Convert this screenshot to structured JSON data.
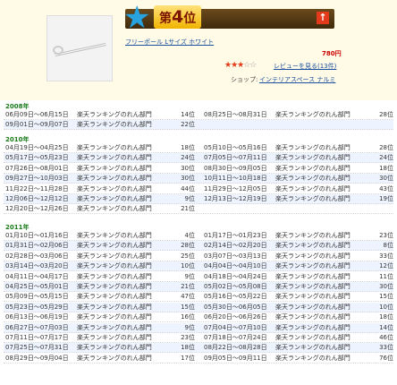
{
  "rank": {
    "prefix": "第",
    "number": "4",
    "suffix": "位",
    "arrow": "↑"
  },
  "product": {
    "name": "フリーポール Lサイズ ホワイト",
    "price": "780円",
    "stars_filled": "★★★",
    "stars_empty": "☆☆",
    "review_link": "レビューを見る(13件)",
    "shop_label": "ショップ:",
    "shop_name": "インテリアスペース ナルミ"
  },
  "history": [
    {
      "year": "2008年",
      "rows": [
        {
          "l_dates": "06月09日～06月15日",
          "l_cat": "楽天ランキングのれん部門",
          "l_pos": "14位",
          "r_dates": "08月25日～08月31日",
          "r_cat": "楽天ランキングのれん部門",
          "r_pos": "28位"
        },
        {
          "l_dates": "09月01日～09月07日",
          "l_cat": "楽天ランキングのれん部門",
          "l_pos": "22位",
          "r_dates": "",
          "r_cat": "",
          "r_pos": ""
        }
      ]
    },
    {
      "year": "2010年",
      "rows": [
        {
          "l_dates": "04月19日～04月25日",
          "l_cat": "楽天ランキングのれん部門",
          "l_pos": "18位",
          "r_dates": "05月10日～05月16日",
          "r_cat": "楽天ランキングのれん部門",
          "r_pos": "28位"
        },
        {
          "l_dates": "05月17日～05月23日",
          "l_cat": "楽天ランキングのれん部門",
          "l_pos": "24位",
          "r_dates": "07月05日～07月11日",
          "r_cat": "楽天ランキングのれん部門",
          "r_pos": "24位"
        },
        {
          "l_dates": "07月26日～08月01日",
          "l_cat": "楽天ランキングのれん部門",
          "l_pos": "30位",
          "r_dates": "08月30日～09月05日",
          "r_cat": "楽天ランキングのれん部門",
          "r_pos": "18位"
        },
        {
          "l_dates": "09月27日～10月03日",
          "l_cat": "楽天ランキングのれん部門",
          "l_pos": "30位",
          "r_dates": "10月11日～10月18日",
          "r_cat": "楽天ランキングのれん部門",
          "r_pos": "30位"
        },
        {
          "l_dates": "11月22日～11月28日",
          "l_cat": "楽天ランキングのれん部門",
          "l_pos": "44位",
          "r_dates": "11月29日～12月05日",
          "r_cat": "楽天ランキングのれん部門",
          "r_pos": "43位"
        },
        {
          "l_dates": "12月06日～12月12日",
          "l_cat": "楽天ランキングのれん部門",
          "l_pos": "9位",
          "r_dates": "12月13日～12月19日",
          "r_cat": "楽天ランキングのれん部門",
          "r_pos": "19位"
        },
        {
          "l_dates": "12月20日～12月26日",
          "l_cat": "楽天ランキングのれん部門",
          "l_pos": "21位",
          "r_dates": "",
          "r_cat": "",
          "r_pos": ""
        }
      ]
    },
    {
      "year": "2011年",
      "rows": [
        {
          "l_dates": "01月10日～01月16日",
          "l_cat": "楽天ランキングのれん部門",
          "l_pos": "4位",
          "r_dates": "01月17日～01月23日",
          "r_cat": "楽天ランキングのれん部門",
          "r_pos": "23位"
        },
        {
          "l_dates": "01月31日～02月06日",
          "l_cat": "楽天ランキングのれん部門",
          "l_pos": "28位",
          "r_dates": "02月14日～02月20日",
          "r_cat": "楽天ランキングのれん部門",
          "r_pos": "8位"
        },
        {
          "l_dates": "02月28日～03月06日",
          "l_cat": "楽天ランキングのれん部門",
          "l_pos": "25位",
          "r_dates": "03月07日～03月13日",
          "r_cat": "楽天ランキングのれん部門",
          "r_pos": "33位"
        },
        {
          "l_dates": "03月14日～03月20日",
          "l_cat": "楽天ランキングのれん部門",
          "l_pos": "10位",
          "r_dates": "04月04日～04月10日",
          "r_cat": "楽天ランキングのれん部門",
          "r_pos": "12位"
        },
        {
          "l_dates": "04月11日～04月17日",
          "l_cat": "楽天ランキングのれん部門",
          "l_pos": "9位",
          "r_dates": "04月18日～04月24日",
          "r_cat": "楽天ランキングのれん部門",
          "r_pos": "11位"
        },
        {
          "l_dates": "04月25日～05月01日",
          "l_cat": "楽天ランキングのれん部門",
          "l_pos": "21位",
          "r_dates": "05月02日～05月08日",
          "r_cat": "楽天ランキングのれん部門",
          "r_pos": "30位"
        },
        {
          "l_dates": "05月09日～05月15日",
          "l_cat": "楽天ランキングのれん部門",
          "l_pos": "47位",
          "r_dates": "05月16日～05月22日",
          "r_cat": "楽天ランキングのれん部門",
          "r_pos": "15位"
        },
        {
          "l_dates": "05月23日～05月29日",
          "l_cat": "楽天ランキングのれん部門",
          "l_pos": "15位",
          "r_dates": "05月30日～06月05日",
          "r_cat": "楽天ランキングのれん部門",
          "r_pos": "10位"
        },
        {
          "l_dates": "06月13日～06月19日",
          "l_cat": "楽天ランキングのれん部門",
          "l_pos": "16位",
          "r_dates": "06月20日～06月26日",
          "r_cat": "楽天ランキングのれん部門",
          "r_pos": "18位"
        },
        {
          "l_dates": "06月27日～07月03日",
          "l_cat": "楽天ランキングのれん部門",
          "l_pos": "9位",
          "r_dates": "07月04日～07月10日",
          "r_cat": "楽天ランキングのれん部門",
          "r_pos": "14位"
        },
        {
          "l_dates": "07月11日～07月17日",
          "l_cat": "楽天ランキングのれん部門",
          "l_pos": "23位",
          "r_dates": "07月18日～07月24日",
          "r_cat": "楽天ランキングのれん部門",
          "r_pos": "46位"
        },
        {
          "l_dates": "07月25日～07月31日",
          "l_cat": "楽天ランキングのれん部門",
          "l_pos": "18位",
          "r_dates": "08月22日～08月28日",
          "r_cat": "楽天ランキングのれん部門",
          "r_pos": "33位"
        },
        {
          "l_dates": "08月29日～09月04日",
          "l_cat": "楽天ランキングのれん部門",
          "l_pos": "17位",
          "r_dates": "09月05日～09月11日",
          "r_cat": "楽天ランキングのれん部門",
          "r_pos": "76位"
        }
      ]
    }
  ],
  "colors": {
    "link": "#1a4fa0",
    "price": "#cc0000",
    "year": "#1a7a1a",
    "card_bg": "#fffbe6",
    "rank_bar": "#4f3512"
  }
}
